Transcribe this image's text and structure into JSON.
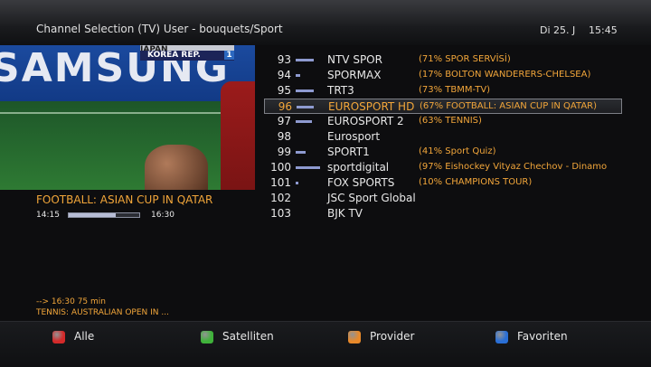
{
  "header": {
    "title": "Channel Selection (TV) User - bouquets/Sport",
    "date": "Di 25. J",
    "time": "15:45"
  },
  "preview": {
    "scoreboard": {
      "team_top": "JAPAN",
      "team_bottom": "KOREA REP.",
      "score_bottom": "1"
    },
    "ad_text": "SAMSUNG",
    "now_title": "FOOTBALL: ASIAN CUP IN QATAR",
    "start": "14:15",
    "end": "16:30",
    "progress": 0.67,
    "next_time": "-->    16:30    75 min",
    "next_title": "TENNIS: AUSTRALIAN OPEN IN ..."
  },
  "channels": [
    {
      "num": "93",
      "name": "NTV SPOR",
      "progress": 0.71,
      "epg": "(71% SPOR SERVİSİ)"
    },
    {
      "num": "94",
      "name": "SPORMAX",
      "progress": 0.17,
      "epg": "(17% BOLTON WANDERERS-CHELSEA)"
    },
    {
      "num": "95",
      "name": "TRT3",
      "progress": 0.73,
      "epg": "(73% TBMM-TV)"
    },
    {
      "num": "96",
      "name": "EUROSPORT HD",
      "progress": 0.67,
      "epg": "(67% FOOTBALL: ASIAN CUP IN QATAR)",
      "selected": true
    },
    {
      "num": "97",
      "name": "EUROSPORT 2",
      "progress": 0.63,
      "epg": "(63% TENNIS)"
    },
    {
      "num": "98",
      "name": "Eurosport",
      "progress": 0,
      "epg": ""
    },
    {
      "num": "99",
      "name": "SPORT1",
      "progress": 0.41,
      "epg": "(41% Sport Quiz)"
    },
    {
      "num": "100",
      "name": "sportdigital",
      "progress": 0.97,
      "epg": "(97% Eishockey  Vityaz Chechov - Dinamo"
    },
    {
      "num": "101",
      "name": "FOX SPORTS",
      "progress": 0.1,
      "epg": "(10% CHAMPIONS TOUR)"
    },
    {
      "num": "102",
      "name": "JSC Sport Global",
      "progress": 0,
      "epg": ""
    },
    {
      "num": "103",
      "name": "BJK TV",
      "progress": 0,
      "epg": ""
    }
  ],
  "footer": {
    "buttons": [
      {
        "label": "Alle",
        "color": "#d42a2a",
        "icon": "red-button-icon"
      },
      {
        "label": "Satelliten",
        "color": "#3fb23a",
        "icon": "green-button-icon"
      },
      {
        "label": "Provider",
        "color": "#e8892a",
        "icon": "yellow-button-icon"
      },
      {
        "label": "Favoriten",
        "color": "#2a6fd6",
        "icon": "blue-button-icon"
      }
    ]
  },
  "colors": {
    "accent": "#f2a63a",
    "progress": "#8e9ad0"
  }
}
